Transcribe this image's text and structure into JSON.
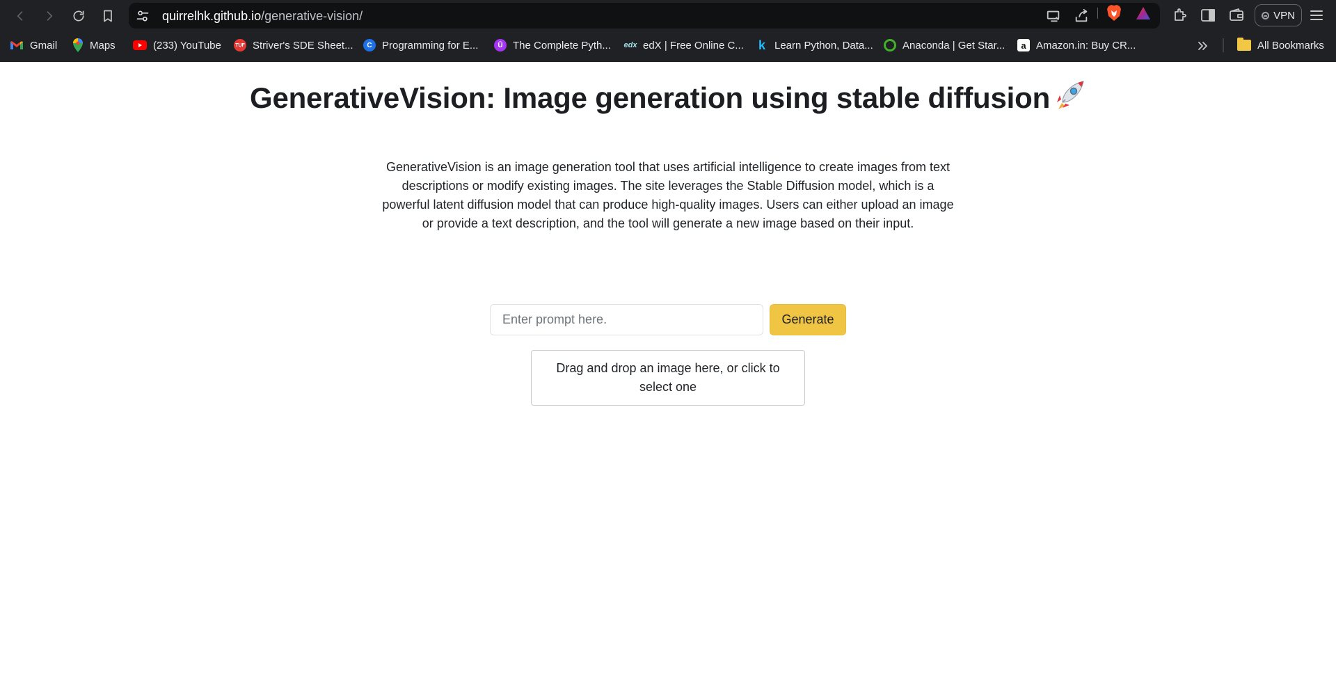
{
  "browser": {
    "url_host": "quirrelhk.github.io",
    "url_path": "/generative-vision/",
    "vpn_label": "VPN",
    "bookmarks": [
      {
        "label": "Gmail",
        "icon": "gmail-icon",
        "color": "#ea4335"
      },
      {
        "label": "Maps",
        "icon": "maps-icon",
        "color": "#34a853"
      },
      {
        "label": "(233) YouTube",
        "icon": "youtube-icon",
        "color": "#ff0000"
      },
      {
        "label": "Striver's SDE Sheet...",
        "icon": "tuf-icon",
        "color": "#e53935"
      },
      {
        "label": "Programming for E...",
        "icon": "coursera-icon",
        "color": "#1f6fe5"
      },
      {
        "label": "The Complete Pyth...",
        "icon": "udemy-icon",
        "color": "#a435f0"
      },
      {
        "label": "edX | Free Online C...",
        "icon": "edx-icon",
        "color": "#02262b"
      },
      {
        "label": "Learn Python, Data...",
        "icon": "kaggle-icon",
        "color": "#20beff"
      },
      {
        "label": "Anaconda | Get Star...",
        "icon": "anaconda-icon",
        "color": "#43b02a"
      },
      {
        "label": "Amazon.in: Buy CR...",
        "icon": "amazon-icon",
        "color": "#ffffff"
      }
    ],
    "all_bookmarks_label": "All Bookmarks"
  },
  "page": {
    "title": "GenerativeVision: Image generation using stable diffusion",
    "description": "GenerativeVision is an image generation tool that uses artificial intelligence to create images from text descriptions or modify existing images. The site leverages the Stable Diffusion model, which is a powerful latent diffusion model that can produce high-quality images. Users can either upload an image or provide a text description, and the tool will generate a new image based on their input.",
    "prompt_placeholder": "Enter prompt here.",
    "prompt_value": "",
    "generate_label": "Generate",
    "dropzone_text": "Drag and drop an image here, or click to select one"
  },
  "colors": {
    "accent_button": "#f0c544",
    "chrome_bg": "#202124",
    "text": "#212529"
  }
}
